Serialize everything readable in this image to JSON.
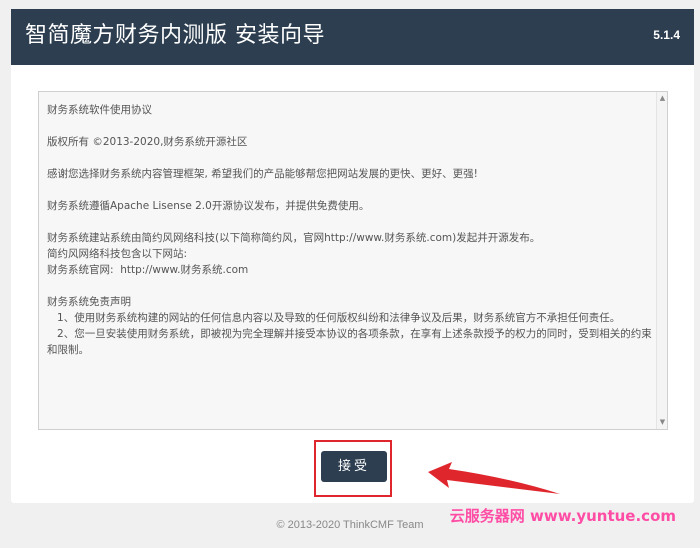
{
  "header": {
    "title": "智简魔方财务内测版 安装向导",
    "version": "5.1.4"
  },
  "agreement": {
    "paragraphs": [
      "财务系统软件使用协议",
      "",
      "版权所有 ©2013-2020,财务系统开源社区",
      "",
      "感谢您选择财务系统内容管理框架, 希望我们的产品能够帮您把网站发展的更快、更好、更强!",
      "",
      "财务系统遵循Apache Lisense 2.0开源协议发布，并提供免费使用。",
      "",
      "财务系统建站系统由简约风网络科技(以下简称简约风，官网http://www.财务系统.com)发起并开源发布。",
      "简约风网络科技包含以下网站:",
      "财务系统官网:  http://www.财务系统.com",
      "",
      "财务系统免责声明",
      "   1、使用财务系统构建的网站的任何信息内容以及导致的任何版权纠纷和法律争议及后果，财务系统官方不承担任何责任。",
      "   2、您一旦安装使用财务系统，即被视为完全理解并接受本协议的各项条款，在享有上述条款授予的权力的同时，受到相关的约束和限制。"
    ]
  },
  "actions": {
    "accept_label": "接受"
  },
  "footer": {
    "copyright": "© 2013-2020 ThinkCMF Team"
  },
  "watermark": {
    "text": "云服务器网 www.yuntue.com"
  },
  "colors": {
    "header_bg": "#2c3e50",
    "highlight": "#e0262d",
    "watermark": "#ff4da6"
  }
}
